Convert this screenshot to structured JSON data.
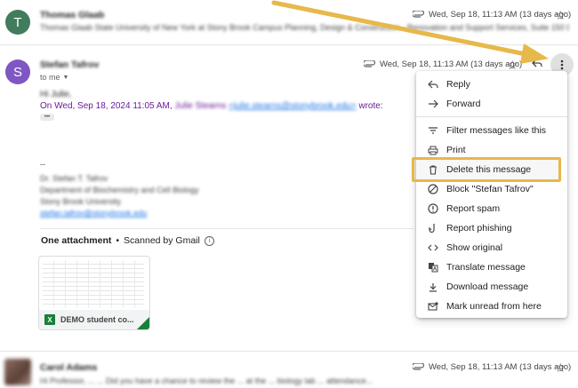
{
  "prev_email": {
    "avatar_letter": "T",
    "sender": "Thomas Glaab",
    "snippet": "Thomas Glaab State University of New York at Stony Brook Campus Planning, Design & Construction - Renovation and Support Services, Suite 150 D...",
    "date": "Wed, Sep 18, 11:13 AM (13 days ago)"
  },
  "current_email": {
    "avatar_letter": "S",
    "sender": "Stefan Tafrov",
    "to": "to me",
    "date": "Wed, Sep 18, 11:13 AM (13 days ago)",
    "greeting": "Hi Julie,",
    "quote_prefix": "On Wed, Sep 18, 2024 11:05 AM, ",
    "quote_name": "Julie Stearns",
    "quote_email": "<julie.stearns@stonybrook.edu>",
    "quote_suffix": " wrote:",
    "ellipsis": "•••",
    "sig_dash": "--",
    "sig_line1": "Dr. Stefan T. Tafrov",
    "sig_line2": "Department of Biochemistry and Cell Biology",
    "sig_line3": "Stony Brook University",
    "sig_link": "stefan.tafrov@stonybrook.edu"
  },
  "attachments": {
    "title": "One attachment",
    "bullet": "•",
    "scanned": "Scanned by Gmail",
    "file_name": "DEMO student co...",
    "file_badge": "X"
  },
  "menu": {
    "items": [
      "Reply",
      "Forward",
      "Filter messages like this",
      "Print",
      "Delete this message",
      "Block \"Stefan Tafrov\"",
      "Report spam",
      "Report phishing",
      "Show original",
      "Translate message",
      "Download message",
      "Mark unread from here"
    ]
  },
  "next_email": {
    "sender": "Carol Adams",
    "snippet": "Hi Professor, ... ... Did you have a chance to review the ... at the ... biology lab ... attendance...",
    "date": "Wed, Sep 18, 11:13 AM (13 days ago)"
  },
  "colors": {
    "avatar_t": "#417c5c",
    "avatar_s": "#7e57c2",
    "quote_purple": "#6a1b9a",
    "link_blue": "#1a73e8",
    "highlight": "#e7b84a",
    "excel_green": "#188038"
  }
}
